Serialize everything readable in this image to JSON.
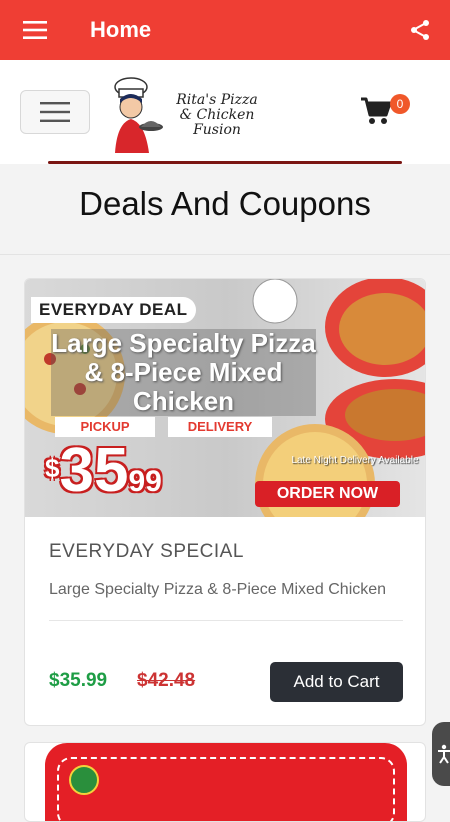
{
  "appbar": {
    "title": "Home",
    "menu_icon": "hamburger-menu-icon",
    "share_icon": "share-icon",
    "color": "#ef3e34"
  },
  "header": {
    "brand": {
      "line1": "Rita's Pizza",
      "line2": "& Chicken",
      "line3": "Fusion"
    },
    "nav_toggle_icon": "hamburger-menu-icon",
    "cart": {
      "icon": "shopping-cart-icon",
      "count": "0"
    }
  },
  "page": {
    "title": "Deals And Coupons"
  },
  "deals": [
    {
      "banner": {
        "chip": "EVERYDAY DEAL",
        "headline": "Large Specialty Pizza & 8-Piece Mixed Chicken",
        "pickup": "PICKUP",
        "delivery": "DELIVERY",
        "price_dollar_sign": "$",
        "price_main": "35",
        "price_cents": "99",
        "late_night": "Late Night Delivery Available",
        "order_now": "ORDER NOW"
      },
      "title": "EVERYDAY SPECIAL",
      "description": "Large Specialty Pizza & 8-Piece Mixed Chicken",
      "price": "$35.99",
      "original_price": "$42.48",
      "add_to_cart": "Add to Cart"
    }
  ],
  "colors": {
    "accent": "#ef3e34",
    "price_green": "#1e9d45",
    "old_price_red": "#cc3333",
    "button_dark": "#2b2f36"
  },
  "accessibility_icon": "accessibility-icon"
}
